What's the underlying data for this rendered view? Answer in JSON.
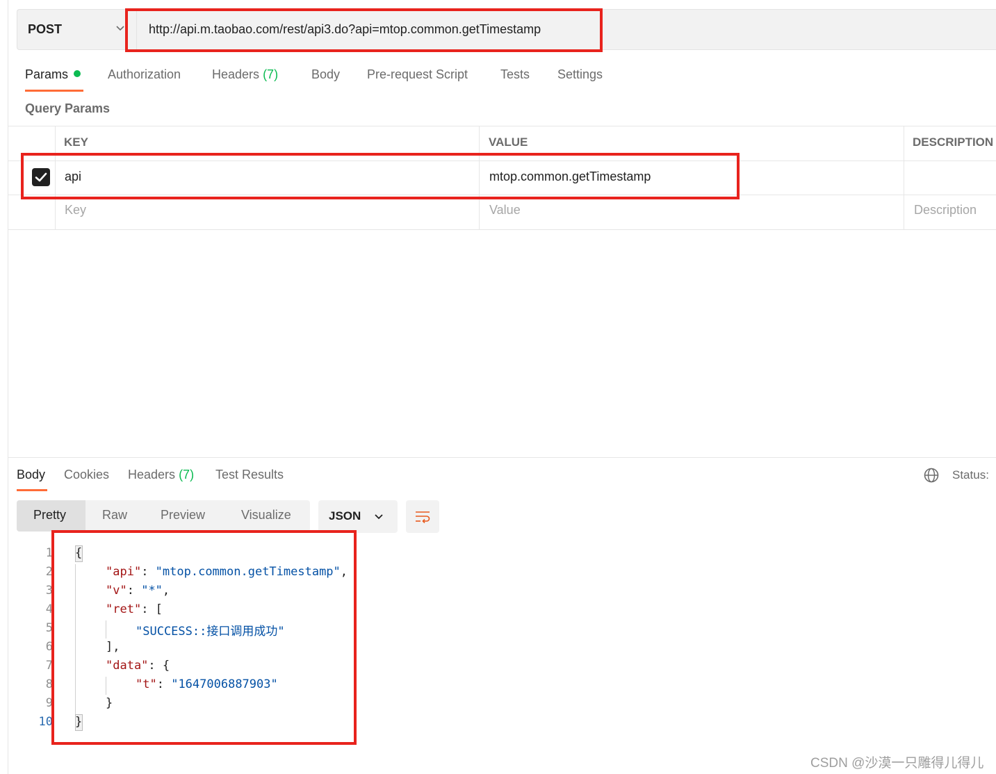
{
  "request": {
    "method": "POST",
    "url": "http://api.m.taobao.com/rest/api3.do?api=mtop.common.getTimestamp"
  },
  "request_tabs": {
    "params": "Params",
    "authorization": "Authorization",
    "headers": "Headers",
    "headers_count": "(7)",
    "body": "Body",
    "prerequest": "Pre-request Script",
    "tests": "Tests",
    "settings": "Settings"
  },
  "query_params": {
    "title": "Query Params",
    "columns": {
      "key": "KEY",
      "value": "VALUE",
      "description": "DESCRIPTION"
    },
    "rows": [
      {
        "checked": true,
        "key": "api",
        "value": "mtop.common.getTimestamp",
        "description": ""
      }
    ],
    "placeholders": {
      "key": "Key",
      "value": "Value",
      "description": "Description"
    }
  },
  "response": {
    "tabs": {
      "body": "Body",
      "cookies": "Cookies",
      "headers": "Headers",
      "headers_count": "(7)",
      "test_results": "Test Results"
    },
    "status_label": "Status: ",
    "view_modes": {
      "pretty": "Pretty",
      "raw": "Raw",
      "preview": "Preview",
      "visualize": "Visualize"
    },
    "format": "JSON",
    "code": {
      "line_numbers": [
        "1",
        "2",
        "3",
        "4",
        "5",
        "6",
        "7",
        "8",
        "9",
        "10"
      ],
      "k_api": "\"api\"",
      "v_api": "\"mtop.common.getTimestamp\"",
      "k_v": "\"v\"",
      "v_v": "\"*\"",
      "k_ret": "\"ret\"",
      "v_ret0": "\"SUCCESS::接口调用成功\"",
      "k_data": "\"data\"",
      "k_t": "\"t\"",
      "v_t": "\"1647006887903\""
    }
  },
  "watermark": "CSDN @沙漠一只雕得儿得儿",
  "colors": {
    "accent": "#ff6c37",
    "green": "#0cbb52",
    "highlight": "#e8231d"
  }
}
